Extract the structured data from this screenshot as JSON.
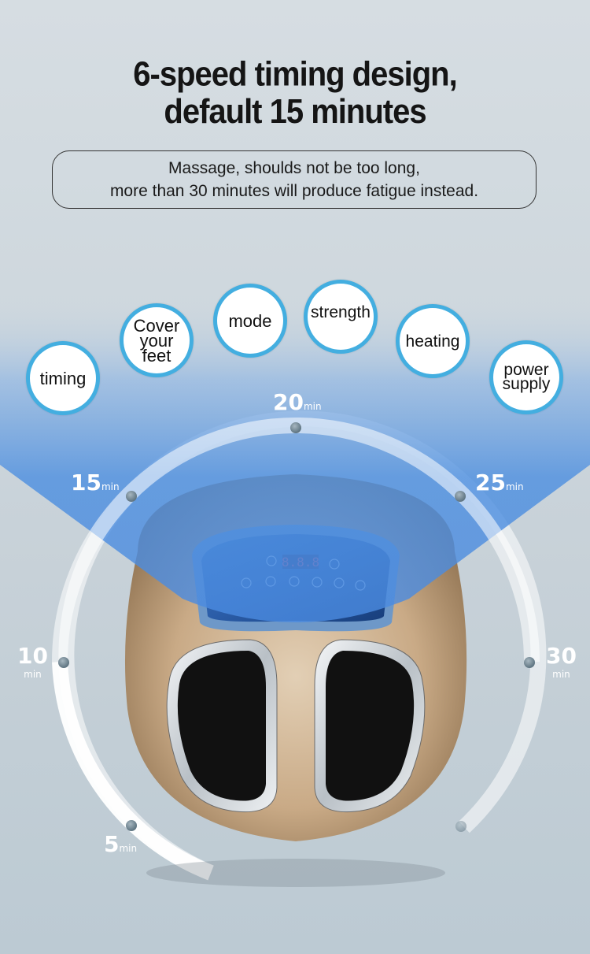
{
  "headline": {
    "line1": "6-speed timing design,",
    "line2": "default 15 minutes"
  },
  "note": {
    "line1": "Massage, shoulds not be too long,",
    "line2": "more than 30 minutes will produce fatigue instead."
  },
  "feature_bubbles": [
    {
      "label": "timing"
    },
    {
      "label": "Cover your feet"
    },
    {
      "label": "mode"
    },
    {
      "label": "strength"
    },
    {
      "label": "heating"
    },
    {
      "label": "power supply"
    }
  ],
  "timer_dial": {
    "unit": "min",
    "settings": [
      {
        "value": "5"
      },
      {
        "value": "10"
      },
      {
        "value": "15"
      },
      {
        "value": "20"
      },
      {
        "value": "25"
      },
      {
        "value": "30"
      }
    ]
  },
  "device": {
    "display_readout": "8.8.8",
    "panel_button_count": 8
  },
  "colors": {
    "accent_blue": "#43aee0",
    "beam_blue": "#4a8ee0",
    "device_gold": "#c9ab88",
    "background": "#cbd5dc"
  }
}
